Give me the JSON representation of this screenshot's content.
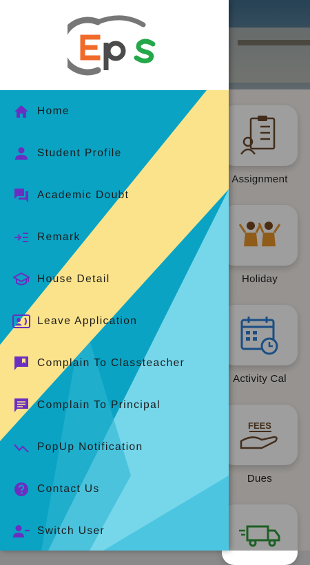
{
  "brand": {
    "logo_text": "Eps",
    "colors": {
      "e": "#f06a2a",
      "p": "#4b4b4b",
      "s": "#24a84a",
      "swoosh": "#777777"
    }
  },
  "menu": {
    "icon_color": "#6a2fc0",
    "items": [
      {
        "label": "Home",
        "icon": "home-icon"
      },
      {
        "label": "Student Profile",
        "icon": "person-icon"
      },
      {
        "label": "Academic Doubt",
        "icon": "chat-icon"
      },
      {
        "label": "Remark",
        "icon": "remark-icon"
      },
      {
        "label": "House Detail",
        "icon": "school-icon"
      },
      {
        "label": "Leave Application",
        "icon": "contact-card-icon"
      },
      {
        "label": "Complain To Classteacher",
        "icon": "bookmark-chat-icon"
      },
      {
        "label": "Complain To Principal",
        "icon": "message-icon"
      },
      {
        "label": "PopUp Notification",
        "icon": "check-trend-icon"
      },
      {
        "label": "Contact Us",
        "icon": "help-icon"
      },
      {
        "label": "Switch User",
        "icon": "person-remove-icon"
      }
    ]
  },
  "background_grid": {
    "tiles": [
      {
        "label": "Assignment",
        "icon": "assignment-icon"
      },
      {
        "label": "Holiday",
        "icon": "holiday-icon"
      },
      {
        "label": "Activity Cal",
        "icon": "calendar-icon"
      },
      {
        "label": "Dues",
        "icon": "fees-icon",
        "icon_text": "FEES"
      },
      {
        "label": "",
        "icon": "transport-icon"
      }
    ]
  }
}
